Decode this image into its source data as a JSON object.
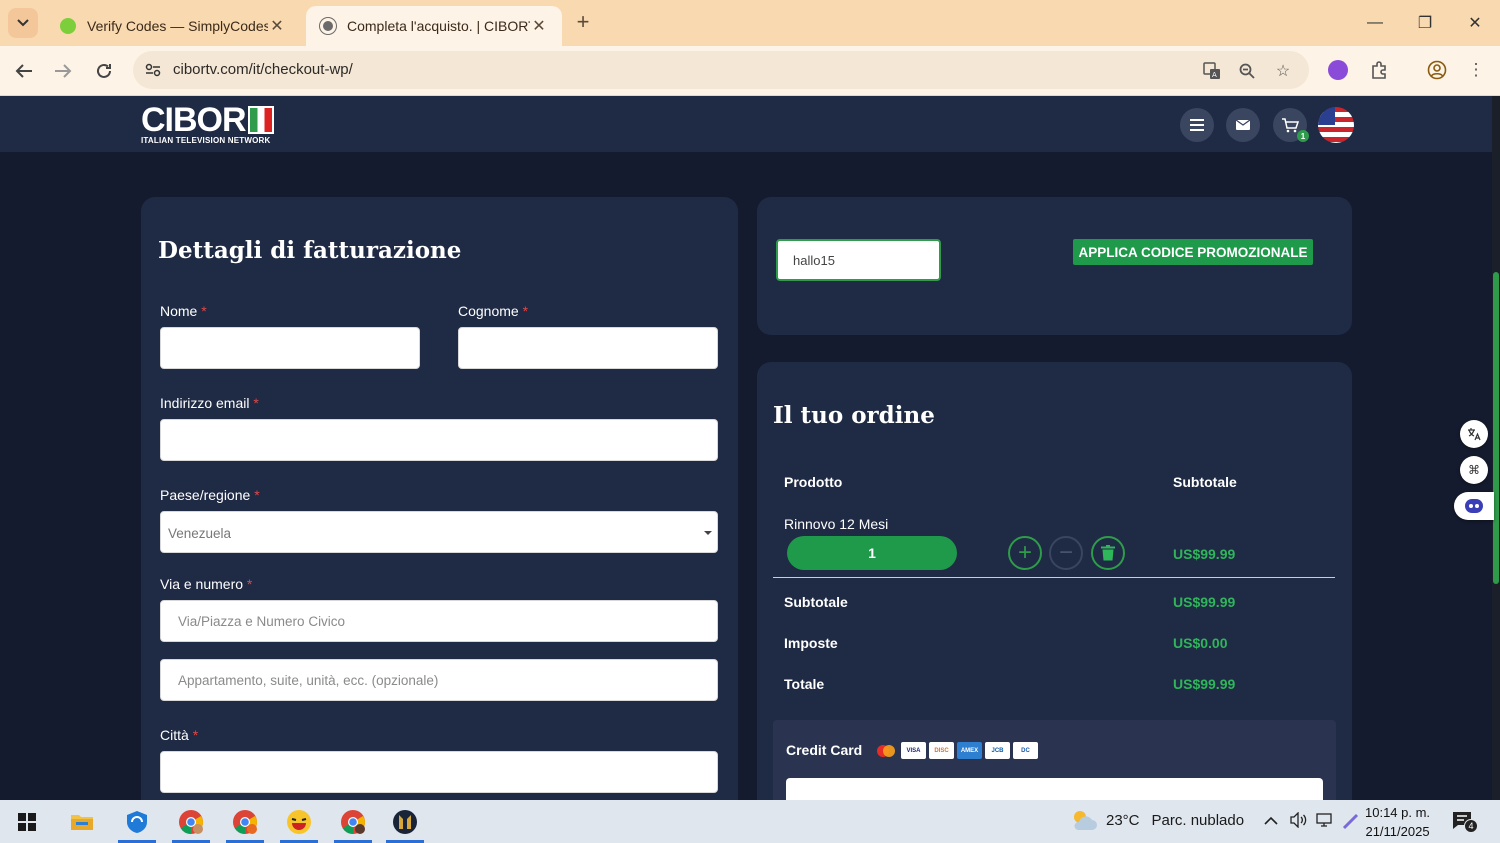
{
  "browser": {
    "tabs": [
      {
        "title": "Verify Codes — SimplyCodes",
        "active": false
      },
      {
        "title": "Completa l'acquisto. | CIBORTV",
        "active": true
      }
    ],
    "url": "cibortv.com/it/checkout-wp/"
  },
  "site": {
    "logo_text": "CIBOR",
    "logo_tag": "ITALIAN TELEVISION NETWORK",
    "cart_count": "1"
  },
  "billing": {
    "title": "Dettagli di fatturazione",
    "required_mark": "*",
    "first_name_label": "Nome",
    "last_name_label": "Cognome",
    "email_label": "Indirizzo email",
    "country_label": "Paese/regione",
    "country_value": "Venezuela",
    "street_label": "Via e numero",
    "street_placeholder": "Via/Piazza e Numero Civico",
    "street2_placeholder": "Appartamento, suite, unità, ecc. (opzionale)",
    "city_label": "Città"
  },
  "promo": {
    "code_value": "hallo15",
    "apply_label": "APPLICA CODICE PROMOZIONALE"
  },
  "order": {
    "title": "Il tuo ordine",
    "col_product": "Prodotto",
    "col_subtotal": "Subtotale",
    "product_name": "Rinnovo 12 Mesi",
    "quantity": "1",
    "line_price": "US$99.99",
    "subtotal_label": "Subtotale",
    "subtotal_value": "US$99.99",
    "tax_label": "Imposte",
    "tax_value": "US$0.00",
    "total_label": "Totale",
    "total_value": "US$99.99"
  },
  "payment": {
    "method_label": "Credit Card",
    "cards": [
      "MC",
      "VISA",
      "DISC",
      "AMEX",
      "JCB",
      "DC"
    ]
  },
  "taskbar": {
    "temperature": "23°C",
    "weather": "Parc. nublado",
    "time": "10:14 p. m.",
    "date": "21/11/2025",
    "notifications": "4"
  },
  "colors": {
    "page_bg": "#141b2e",
    "card_bg": "#1f2a44",
    "accent_green": "#1f9a4b",
    "price_green": "#2fb55a",
    "required_red": "#e04848"
  }
}
